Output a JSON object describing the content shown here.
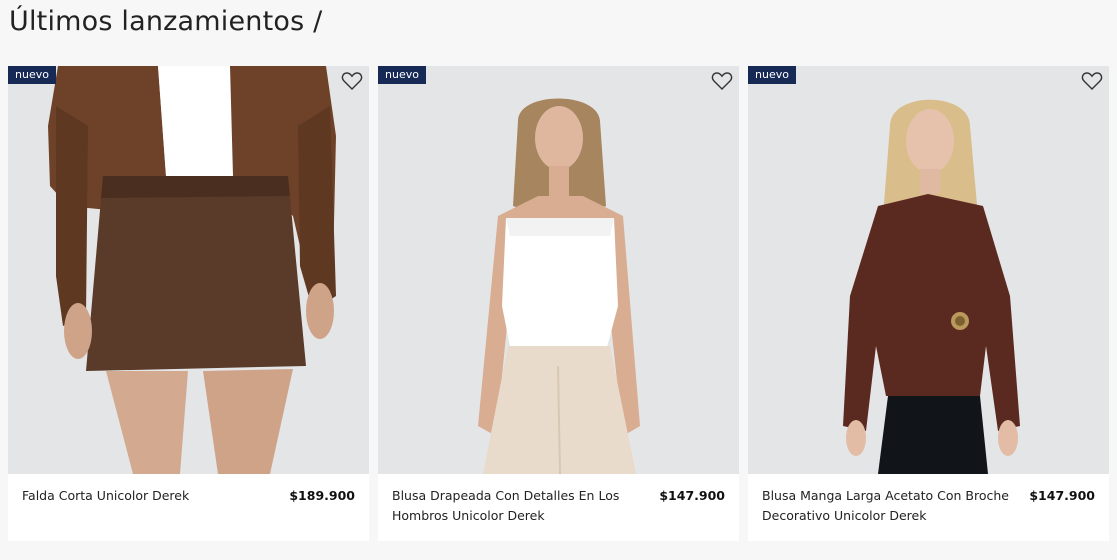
{
  "section": {
    "title": "Últimos lanzamientos /"
  },
  "products": [
    {
      "badge": "nuevo",
      "name": "Falda Corta Unicolor Derek",
      "price": "$189.900",
      "favorite_icon": "heart-outline-icon"
    },
    {
      "badge": "nuevo",
      "name": "Blusa Drapeada Con Detalles En Los Hombros Unicolor Derek",
      "price": "$147.900",
      "favorite_icon": "heart-outline-icon"
    },
    {
      "badge": "nuevo",
      "name": "Blusa Manga Larga Acetato Con Broche Decorativo Unicolor Derek",
      "price": "$147.900",
      "favorite_icon": "heart-outline-icon"
    }
  ],
  "colors": {
    "badge_bg": "#172a56",
    "page_bg": "#f7f7f7",
    "image_bg": "#e5e6e8"
  }
}
